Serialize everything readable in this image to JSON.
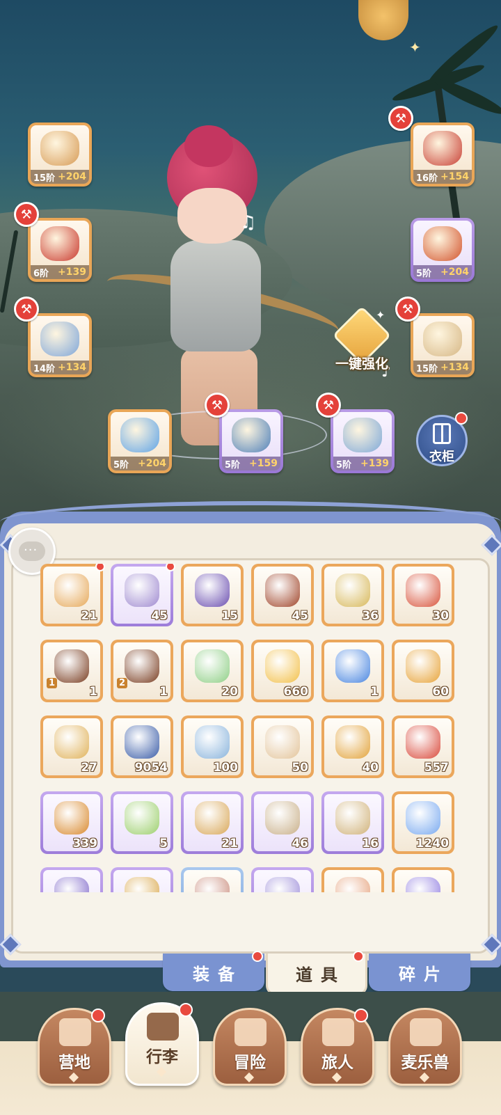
{
  "equipment": [
    {
      "slot": "weapon",
      "tier": "15阶",
      "bonus": "+204",
      "rarity": "orange",
      "art_color": "#d79b56",
      "can_upgrade": false
    },
    {
      "slot": "helmet",
      "tier": "16阶",
      "bonus": "+154",
      "rarity": "orange",
      "art_color": "#c84136",
      "can_upgrade": true
    },
    {
      "slot": "armor",
      "tier": "6阶",
      "bonus": "+139",
      "rarity": "orange",
      "art_color": "#c9392e",
      "can_upgrade": true
    },
    {
      "slot": "gloves",
      "tier": "5阶",
      "bonus": "+204",
      "rarity": "purple",
      "art_color": "#d2542d",
      "can_upgrade": false
    },
    {
      "slot": "pants",
      "tier": "14阶",
      "bonus": "+134",
      "rarity": "orange",
      "art_color": "#7fa6d9",
      "can_upgrade": true
    },
    {
      "slot": "boots",
      "tier": "15阶",
      "bonus": "+134",
      "rarity": "orange",
      "art_color": "#d6b785",
      "can_upgrade": true
    },
    {
      "slot": "ring",
      "tier": "5阶",
      "bonus": "+204",
      "rarity": "orange",
      "art_color": "#5fa3e6",
      "can_upgrade": false
    },
    {
      "slot": "necklace",
      "tier": "5阶",
      "bonus": "+159",
      "rarity": "purple",
      "art_color": "#4f80b9",
      "can_upgrade": true
    },
    {
      "slot": "amulet",
      "tier": "5阶",
      "bonus": "+139",
      "rarity": "purple",
      "art_color": "#7ea8d8",
      "can_upgrade": true
    }
  ],
  "enhance_label": "一键强化",
  "wardrobe_label": "衣柜",
  "inventory": [
    {
      "count": "21",
      "rarity": "orange",
      "art": "#e6a95a",
      "dot": true
    },
    {
      "count": "45",
      "rarity": "purple",
      "art": "#9f8ad0",
      "dot": true
    },
    {
      "count": "15",
      "rarity": "orange",
      "art": "#6b4fb0",
      "dot": false
    },
    {
      "count": "45",
      "rarity": "orange",
      "art": "#a0462b",
      "dot": false
    },
    {
      "count": "36",
      "rarity": "orange",
      "art": "#d7b85a",
      "dot": false
    },
    {
      "count": "30",
      "rarity": "orange",
      "art": "#d8543c",
      "dot": false
    },
    {
      "count": "1",
      "level": "1",
      "rarity": "orange",
      "art": "#7a3e22",
      "dot": false
    },
    {
      "count": "1",
      "level": "2",
      "rarity": "orange",
      "art": "#7a3e22",
      "dot": false
    },
    {
      "count": "20",
      "rarity": "orange",
      "art": "#8fcf86",
      "dot": false
    },
    {
      "count": "660",
      "rarity": "orange",
      "art": "#f2c04a",
      "dot": false
    },
    {
      "count": "1",
      "rarity": "orange",
      "art": "#4a86e0",
      "dot": false
    },
    {
      "count": "60",
      "rarity": "orange",
      "art": "#e7a43a",
      "dot": false
    },
    {
      "count": "27",
      "rarity": "orange",
      "art": "#e0b25a",
      "dot": false
    },
    {
      "count": "9054",
      "rarity": "orange",
      "art": "#3c5ea8",
      "dot": false
    },
    {
      "count": "100",
      "rarity": "orange",
      "art": "#8ab4dc",
      "dot": false
    },
    {
      "count": "50",
      "rarity": "orange",
      "art": "#e3c49a",
      "dot": false
    },
    {
      "count": "40",
      "rarity": "orange",
      "art": "#e2a33b",
      "dot": false
    },
    {
      "count": "557",
      "rarity": "orange",
      "art": "#d94a3c",
      "dot": false
    },
    {
      "count": "339",
      "rarity": "purple",
      "art": "#d98a2f",
      "dot": false
    },
    {
      "count": "5",
      "rarity": "purple",
      "art": "#9ccf6d",
      "dot": false
    },
    {
      "count": "21",
      "rarity": "purple",
      "art": "#d9a85a",
      "dot": false
    },
    {
      "count": "46",
      "rarity": "purple",
      "art": "#c9b08a",
      "dot": false
    },
    {
      "count": "16",
      "rarity": "purple",
      "art": "#d0b27a",
      "dot": false
    },
    {
      "count": "1240",
      "rarity": "orange",
      "art": "#7aaaf0",
      "dot": false
    },
    {
      "count": "",
      "rarity": "purple",
      "art": "#7e66c9",
      "dot": false
    },
    {
      "count": "",
      "rarity": "purple",
      "art": "#d9a647",
      "dot": false
    },
    {
      "count": "",
      "rarity": "blue",
      "art": "#c98a7a",
      "dot": false
    },
    {
      "count": "",
      "rarity": "purple",
      "art": "#9a8ad8",
      "dot": false
    },
    {
      "count": "",
      "rarity": "orange",
      "art": "#e5a07a",
      "dot": false
    },
    {
      "count": "",
      "rarity": "orange",
      "art": "#8e7ae0",
      "dot": false
    }
  ],
  "subtabs": [
    {
      "label": "装备",
      "active": false,
      "dot": true
    },
    {
      "label": "道具",
      "active": true,
      "dot": true
    },
    {
      "label": "碎片",
      "active": false,
      "dot": false
    }
  ],
  "nav": [
    {
      "label": "营地",
      "icon": "castle-icon",
      "active": false,
      "dot": true
    },
    {
      "label": "行李",
      "icon": "backpack-icon",
      "active": true,
      "dot": true
    },
    {
      "label": "冒险",
      "icon": "crossed-swords-icon",
      "active": false,
      "dot": false
    },
    {
      "label": "旅人",
      "icon": "traveler-portrait-icon",
      "active": false,
      "dot": true
    },
    {
      "label": "麦乐兽",
      "icon": "cat-face-icon",
      "active": false,
      "dot": false
    }
  ]
}
